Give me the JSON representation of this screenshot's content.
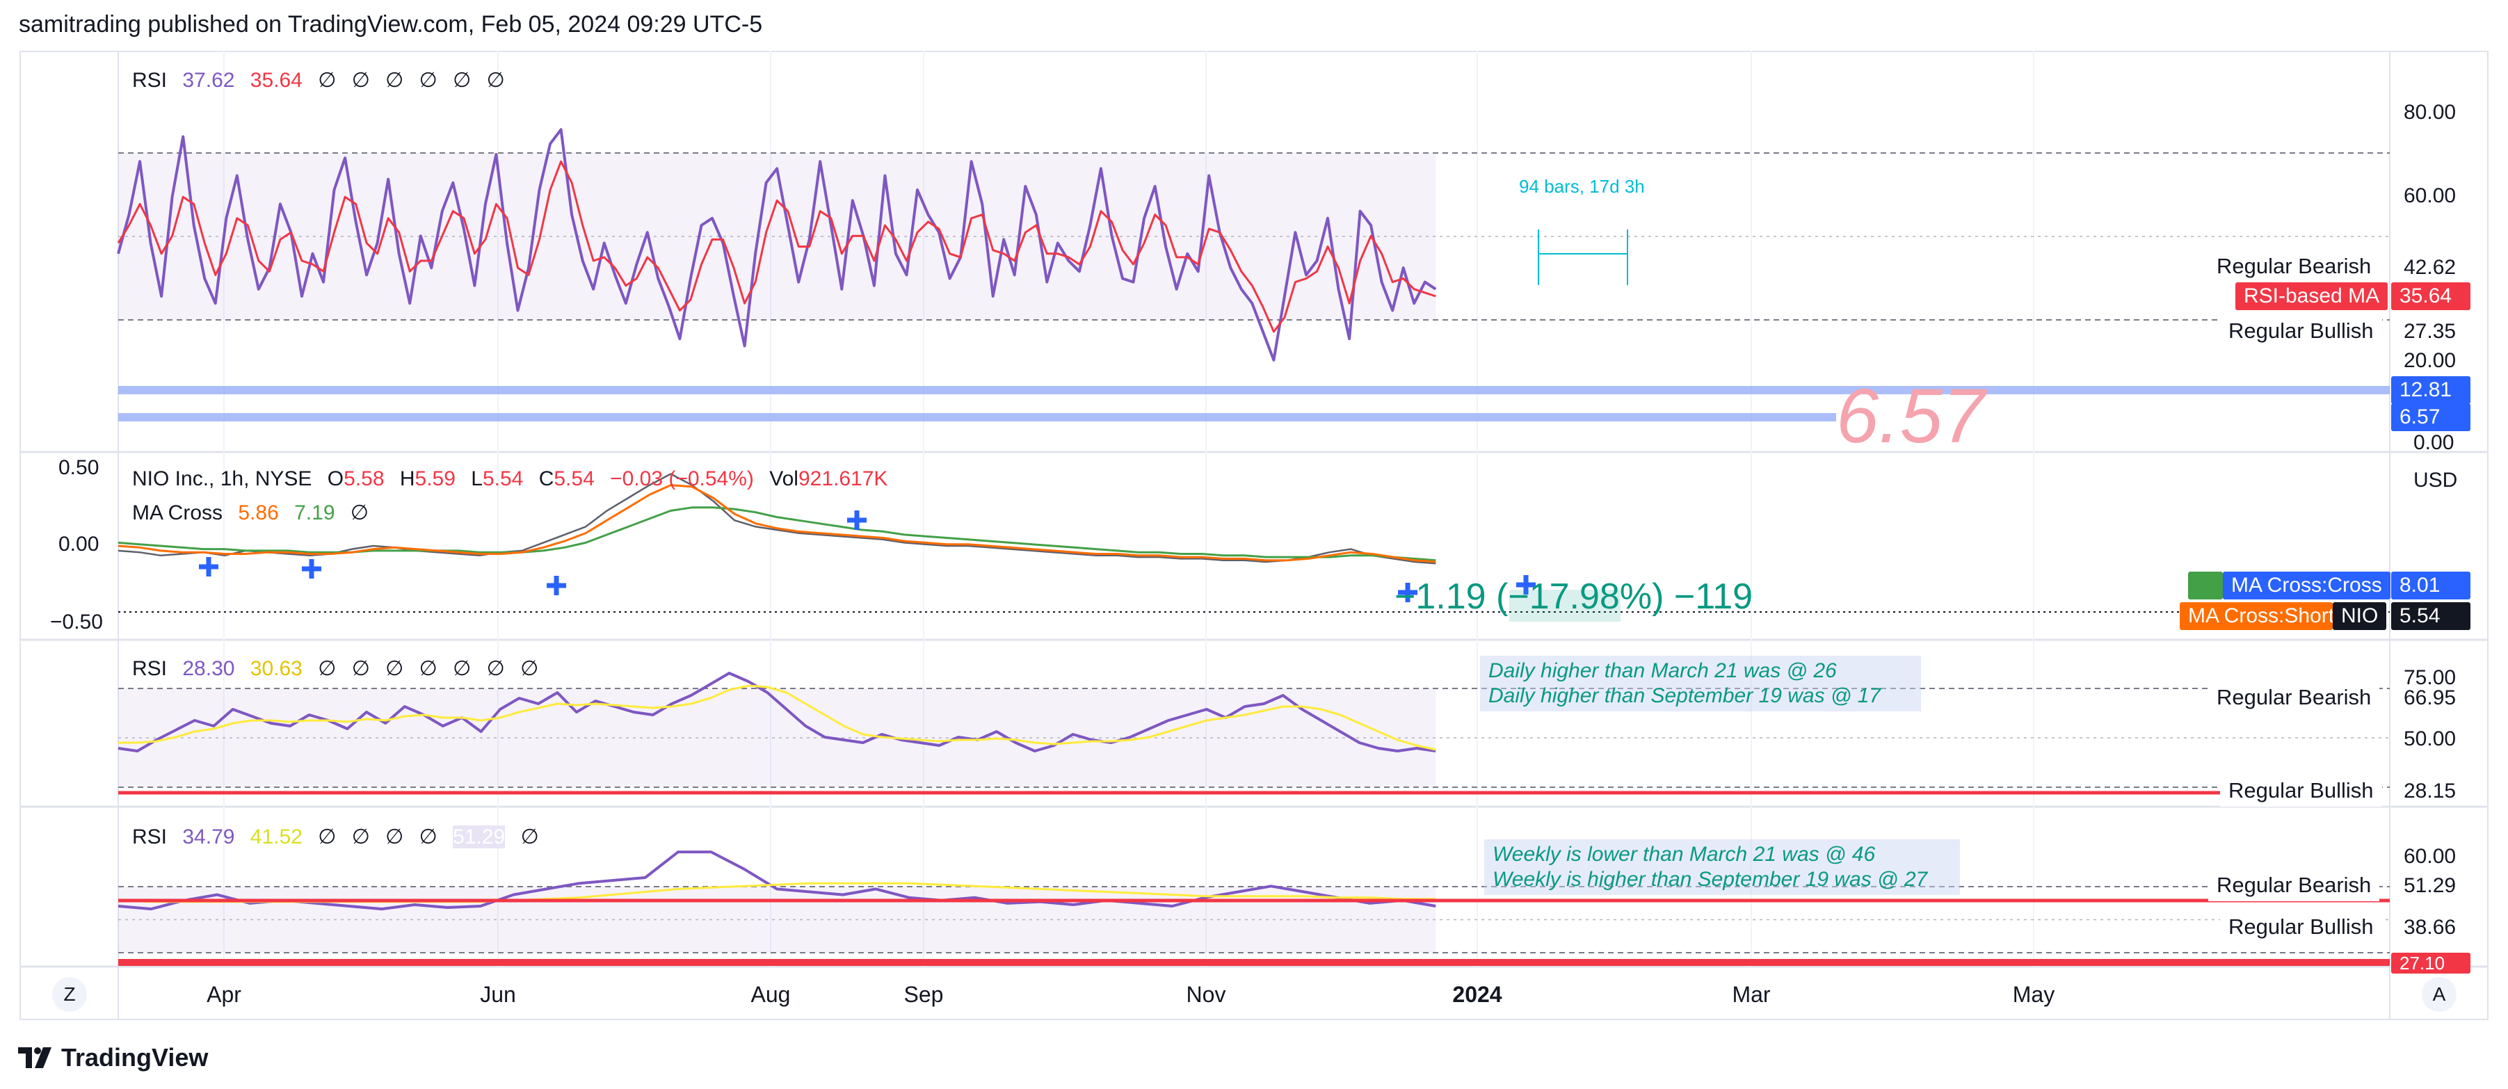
{
  "header": {
    "publisher_text": "samitrading published on TradingView.com, Feb 05, 2024 09:29 UTC-5"
  },
  "footer": {
    "brand": "TradingView",
    "logo_icon": "tradingview-logo-icon"
  },
  "colors": {
    "rsi_line": "#7e57c2",
    "rsi_ma": "#f23645",
    "rsi_ma_yellow": "#ffeb3b",
    "ma_fast": "#ff6d00",
    "ma_slow": "#43a047",
    "band_fill": "#7e57c2",
    "hline_blue": "#90a8f8",
    "hline_red": "#f23645",
    "cross_marker": "#2962ff",
    "measure": "#00bcd4",
    "price_change": "#089981"
  },
  "pane1": {
    "legend": {
      "name": "RSI",
      "value1": "37.62",
      "value2": "35.64",
      "placeholders": [
        "∅",
        "∅",
        "∅",
        "∅",
        "∅",
        "∅"
      ]
    },
    "axis_labels": [
      "80.00",
      "60.00",
      "20.00",
      "0.00"
    ],
    "big_watermark": "6.57",
    "measure_text": "94 bars, 17d 3h",
    "right_labels": {
      "regular_bearish": "Regular Bearish",
      "regular_bearish_value": "42.62",
      "rsi_ma_label": "RSI-based MA",
      "rsi_ma_value": "35.64",
      "regular_bullish": "Regular Bullish",
      "regular_bullish_value": "27.35",
      "line1_value": "12.81",
      "line2_value": "6.57"
    },
    "series_rsi": [
      52,
      63,
      78,
      55,
      40,
      68,
      85,
      60,
      45,
      38,
      62,
      74,
      56,
      42,
      48,
      66,
      58,
      40,
      52,
      44,
      70,
      79,
      61,
      46,
      55,
      73,
      52,
      38,
      57,
      48,
      64,
      72,
      59,
      43,
      66,
      80,
      55,
      36,
      48,
      70,
      83,
      87,
      63,
      50,
      42,
      55,
      46,
      38,
      49,
      58,
      45,
      37,
      28,
      45,
      60,
      62,
      55,
      40,
      26,
      52,
      72,
      76,
      60,
      44,
      56,
      78,
      60,
      42,
      67,
      57,
      43,
      74,
      52,
      46,
      70,
      63,
      58,
      45,
      51,
      78,
      66,
      40,
      56,
      46,
      71,
      63,
      44,
      55,
      50,
      47,
      60,
      76,
      57,
      45,
      44,
      62,
      71,
      54,
      42,
      52,
      47,
      74,
      58,
      48,
      42,
      38,
      30,
      22,
      40,
      58,
      46,
      50,
      62,
      42,
      28,
      64,
      60,
      44,
      36,
      48,
      38,
      44,
      42
    ],
    "series_ma": [
      55,
      60,
      66,
      60,
      52,
      57,
      68,
      66,
      55,
      46,
      52,
      62,
      60,
      50,
      47,
      56,
      58,
      50,
      49,
      47,
      58,
      68,
      66,
      55,
      52,
      62,
      58,
      47,
      50,
      50,
      57,
      64,
      62,
      52,
      56,
      66,
      62,
      48,
      46,
      56,
      70,
      78,
      72,
      60,
      50,
      51,
      48,
      43,
      45,
      51,
      48,
      42,
      36,
      39,
      49,
      56,
      56,
      48,
      38,
      44,
      58,
      67,
      64,
      54,
      54,
      64,
      62,
      52,
      57,
      57,
      50,
      60,
      56,
      50,
      58,
      61,
      59,
      52,
      51,
      62,
      63,
      53,
      52,
      50,
      58,
      60,
      52,
      52,
      51,
      49,
      54,
      64,
      61,
      53,
      49,
      55,
      63,
      60,
      51,
      51,
      49,
      59,
      58,
      53,
      47,
      43,
      37,
      30,
      34,
      44,
      45,
      47,
      54,
      48,
      38,
      50,
      57,
      52,
      44,
      45,
      42,
      41,
      40
    ]
  },
  "pane2": {
    "legend": {
      "ticker": "NIO Inc., 1h, NYSE",
      "o_label": "O",
      "o_value": "5.58",
      "h_label": "H",
      "h_value": "5.59",
      "l_label": "L",
      "l_value": "5.54",
      "c_label": "C",
      "c_value": "5.54",
      "change": "−0.03 (−0.54%)",
      "vol_label": "Vol",
      "vol_value": "921.617K"
    },
    "ma_legend": {
      "name": "MA Cross",
      "value1": "5.86",
      "value2": "7.19",
      "placeholder": "∅"
    },
    "axis_labels": [
      "0.50",
      "0.00",
      "−0.50"
    ],
    "currency": "USD",
    "price_change_text": "−1.19 (−17.98%) −119",
    "right_labels": {
      "ma_cross_label": "MA Cross:Cross",
      "ma_cross_value": "8.01",
      "ma_short_label": "MA Cross:Short",
      "nio_label": "NIO",
      "nio_value": "5.54"
    },
    "series_price": [
      47,
      46,
      44,
      45,
      46,
      44,
      47,
      46,
      45,
      44,
      45,
      48,
      50,
      49,
      47,
      46,
      45,
      44,
      46,
      47,
      52,
      57,
      62,
      72,
      80,
      88,
      95,
      88,
      78,
      66,
      62,
      60,
      58,
      57,
      56,
      55,
      54,
      52,
      51,
      50,
      50,
      49,
      48,
      47,
      46,
      45,
      44,
      44,
      43,
      43,
      42,
      42,
      41,
      41,
      40,
      41,
      43,
      46,
      48,
      44,
      42,
      40,
      39
    ],
    "series_ma_fast": [
      50,
      49,
      47,
      46,
      46,
      45,
      45,
      46,
      46,
      45,
      45,
      46,
      48,
      49,
      48,
      47,
      46,
      45,
      45,
      46,
      49,
      53,
      58,
      66,
      74,
      82,
      88,
      87,
      80,
      70,
      64,
      61,
      59,
      58,
      57,
      56,
      55,
      53,
      52,
      51,
      51,
      50,
      49,
      48,
      47,
      46,
      45,
      45,
      44,
      44,
      43,
      43,
      42,
      42,
      41,
      41,
      42,
      44,
      46,
      45,
      43,
      41,
      40
    ],
    "series_ma_slow": [
      52,
      51,
      50,
      49,
      48,
      48,
      47,
      47,
      47,
      46,
      46,
      46,
      47,
      47,
      47,
      47,
      47,
      46,
      46,
      46,
      47,
      49,
      52,
      57,
      62,
      67,
      72,
      74,
      74,
      73,
      71,
      68,
      66,
      64,
      62,
      60,
      59,
      57,
      56,
      55,
      54,
      53,
      52,
      51,
      50,
      49,
      48,
      47,
      46,
      46,
      45,
      45,
      44,
      44,
      43,
      43,
      43,
      43,
      44,
      44,
      43,
      42,
      41
    ]
  },
  "pane3": {
    "legend": {
      "name": "RSI",
      "value1": "28.30",
      "value2": "30.63",
      "placeholders": [
        "∅",
        "∅",
        "∅",
        "∅",
        "∅",
        "∅",
        "∅"
      ]
    },
    "axis_labels": [
      "75.00",
      "50.00"
    ],
    "annotation_line1": "Daily higher than March 21 was @ 26",
    "annotation_line2": "Daily higher than September 19 was @ 17",
    "right_labels": {
      "regular_bearish": "Regular Bearish",
      "regular_bearish_value": "66.95",
      "regular_bullish": "Regular Bullish",
      "regular_bullish_value": "28.15"
    },
    "series_rsi": [
      32,
      30,
      38,
      45,
      52,
      48,
      60,
      55,
      50,
      48,
      56,
      52,
      46,
      58,
      50,
      62,
      56,
      48,
      54,
      44,
      60,
      68,
      64,
      72,
      58,
      66,
      62,
      58,
      56,
      64,
      70,
      78,
      86,
      80,
      72,
      60,
      48,
      40,
      38,
      36,
      42,
      38,
      36,
      34,
      40,
      38,
      44,
      36,
      30,
      34,
      42,
      38,
      36,
      40,
      46,
      52,
      56,
      60,
      54,
      62,
      64,
      70,
      60,
      52,
      44,
      36,
      32,
      30,
      32,
      30
    ],
    "series_ma": [
      36,
      36,
      37,
      40,
      44,
      46,
      50,
      52,
      52,
      51,
      52,
      52,
      51,
      53,
      52,
      55,
      56,
      54,
      54,
      52,
      54,
      58,
      61,
      64,
      63,
      64,
      63,
      62,
      61,
      62,
      64,
      68,
      74,
      77,
      76,
      72,
      64,
      56,
      48,
      42,
      40,
      39,
      38,
      37,
      38,
      38,
      39,
      38,
      36,
      35,
      36,
      37,
      37,
      38,
      40,
      44,
      48,
      52,
      54,
      56,
      59,
      62,
      62,
      60,
      56,
      50,
      44,
      38,
      34,
      31
    ]
  },
  "pane4": {
    "legend": {
      "name": "RSI",
      "value1": "34.79",
      "value2": "41.52",
      "placeholders": [
        "∅",
        "∅",
        "∅",
        "∅"
      ],
      "value3": "51.29",
      "placeholder_last": "∅"
    },
    "axis_labels": [
      "60.00"
    ],
    "annotation_line1": "Weekly is lower than March 21 was @ 46",
    "annotation_line2": "Weekly is higher than September 19 was @ 27",
    "right_labels": {
      "regular_bearish": "Regular Bearish",
      "regular_bearish_value": "51.29",
      "regular_bullish": "Regular Bullish",
      "regular_bullish_value": "38.66",
      "red_line_value": "27.10"
    },
    "series_rsi": [
      40,
      38,
      44,
      48,
      42,
      44,
      42,
      40,
      38,
      41,
      39,
      40,
      48,
      52,
      56,
      58,
      60,
      78,
      78,
      66,
      52,
      50,
      48,
      52,
      46,
      44,
      46,
      42,
      43,
      41,
      44,
      42,
      40,
      46,
      50,
      54,
      50,
      46,
      42,
      44,
      40
    ],
    "series_ma": [
      44,
      43,
      43,
      43,
      43,
      43,
      43,
      43,
      43,
      43,
      43,
      43,
      44,
      45,
      46,
      48,
      50,
      52,
      53,
      54,
      55,
      56,
      56,
      56,
      56,
      55,
      54,
      53,
      52,
      51,
      50,
      49,
      48,
      47,
      47,
      47,
      47,
      46,
      46,
      45,
      45
    ]
  },
  "time_axis": {
    "labels": [
      "Apr",
      "Jun",
      "Aug",
      "Sep",
      "Nov",
      "2024",
      "Mar",
      "May"
    ],
    "left_button": "Z",
    "right_button": "A"
  }
}
